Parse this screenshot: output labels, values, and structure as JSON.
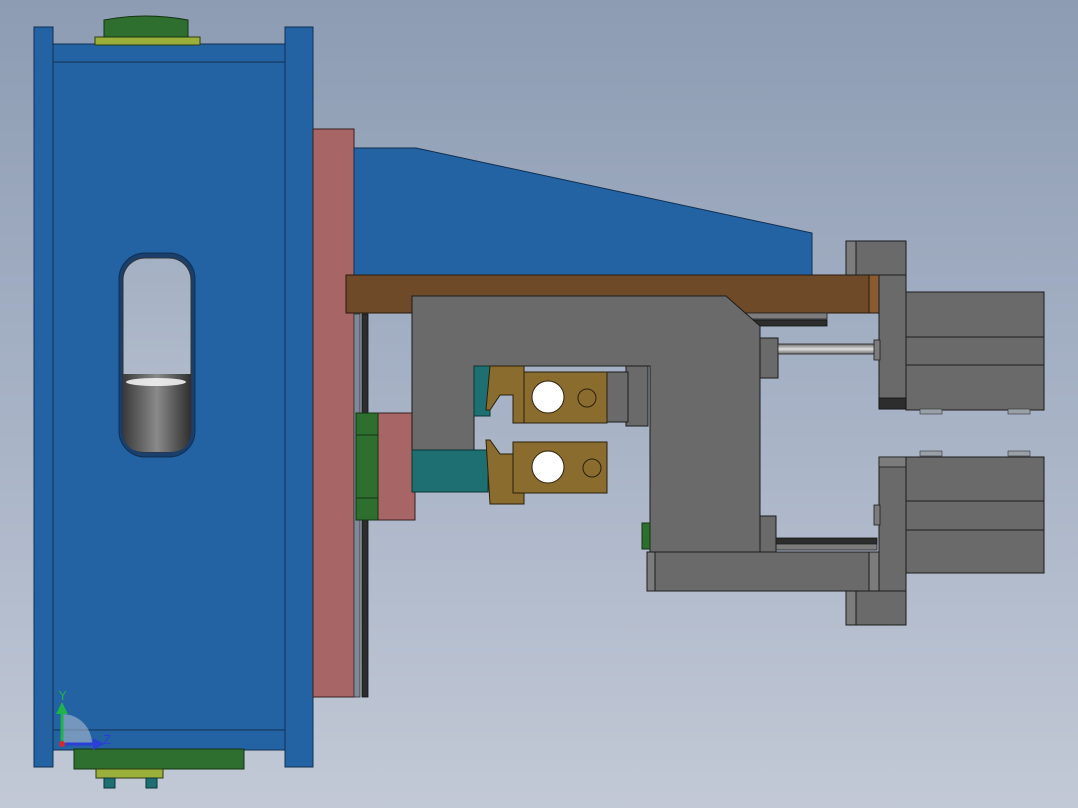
{
  "viewport": {
    "background_top": "#8d9cb3",
    "background_bottom": "#c2c9d6"
  },
  "model": {
    "parts": [
      {
        "name": "main-frame",
        "color": "#2463a3"
      },
      {
        "name": "mounting-plate",
        "color": "#a76565"
      },
      {
        "name": "wedge-support",
        "color": "#2463a3"
      },
      {
        "name": "top-rail",
        "color": "#6e4a28"
      },
      {
        "name": "c-frame-clamp",
        "color": "#6a6a6a"
      },
      {
        "name": "electrode-holders",
        "color": "#8a6c2e"
      },
      {
        "name": "teal-blocks",
        "color": "#1e6f72"
      },
      {
        "name": "green-pads",
        "color": "#2e6e2e"
      },
      {
        "name": "cylinders",
        "color": "#6a6a6a"
      }
    ]
  },
  "triad": {
    "y_label": "Y",
    "z_label": "Z",
    "y_color": "#1db34a",
    "z_color": "#2b3fd6",
    "x_color": "#d42a2a"
  }
}
